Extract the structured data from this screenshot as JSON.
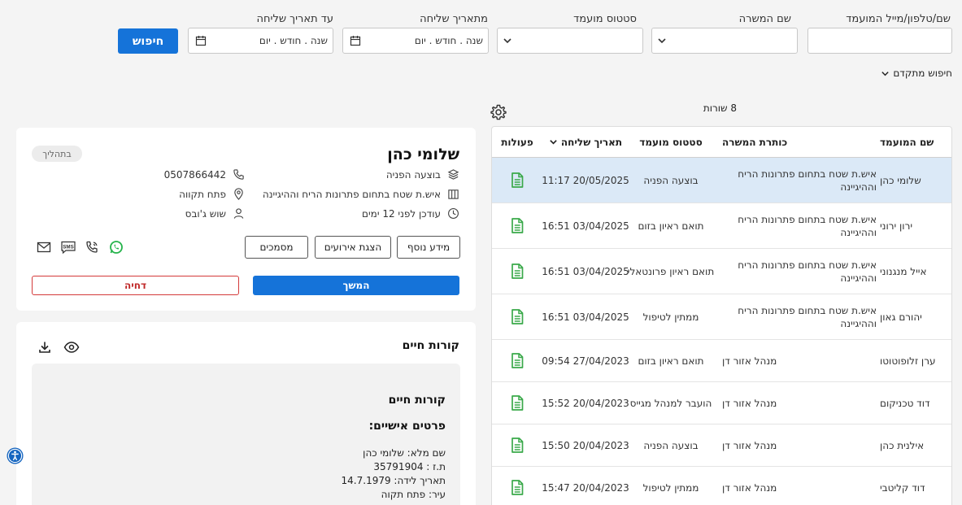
{
  "filters": {
    "candidate_search": {
      "label": "שם/טלפון/מייל המועמד",
      "value": ""
    },
    "job_name": {
      "label": "שם המשרה",
      "value": ""
    },
    "candidate_status": {
      "label": "סטטוס מועמד",
      "value": ""
    },
    "from_date": {
      "label": "מתאריך שליחה",
      "placeholder": "שנה . חודש . יום"
    },
    "to_date": {
      "label": "עד תאריך שליחה",
      "placeholder": "שנה . חודש . יום"
    },
    "search_label": "חיפוש",
    "advanced_search_label": "חיפוש מתקדם"
  },
  "table": {
    "row_count": "8 שורות",
    "headers": {
      "name": "שם המועמד",
      "job": "כותרת המשרה",
      "status": "סטטוס מועמד",
      "date": "תאריך שליחה",
      "actions": "פעולות"
    },
    "rows": [
      {
        "name": "שלומי כהן",
        "job": "איש.ת שטח בתחום פתרונות הריח וההיגיינה",
        "status": "בוצעה הפניה",
        "date": "20/05/2025 11:17"
      },
      {
        "name": "ירון ירוני",
        "job": "איש.ת שטח בתחום פתרונות הריח וההיגיינה",
        "status": "תואם ראיון בזום",
        "date": "03/04/2025 16:51"
      },
      {
        "name": "אייל מנגנוני",
        "job": "איש.ת שטח בתחום פתרונות הריח וההיגיינה",
        "status": "תואם ראיון פרונטאלי",
        "date": "03/04/2025 16:51"
      },
      {
        "name": "יהורם גאון",
        "job": "איש.ת שטח בתחום פתרונות הריח וההיגיינה",
        "status": "ממתין לטיפול",
        "date": "03/04/2025 16:51"
      },
      {
        "name": "ערן זלופוטוטו",
        "job": "מנהל אזור דן",
        "status": "תואם ראיון בזום",
        "date": "27/04/2023 09:54"
      },
      {
        "name": "דוד טכניקום",
        "job": "מנהל אזור דן",
        "status": "הועבר למנהל מגייס",
        "date": "20/04/2023 15:52"
      },
      {
        "name": "אילנית כהן",
        "job": "מנהל אזור דן",
        "status": "בוצעה הפניה",
        "date": "20/04/2023 15:50"
      },
      {
        "name": "דוד קליטבי",
        "job": "מנהל אזור דן",
        "status": "ממתין לטיפול",
        "date": "20/04/2023 15:47"
      }
    ]
  },
  "candidate": {
    "name": "שלומי כהן",
    "status_badge": "בתהליך",
    "phone": "0507866442",
    "stage": "בוצעה הפניה",
    "city": "פתח תקווה",
    "job": "איש.ת שטח בתחום פתרונות הריח וההיגיינה",
    "recruiter": "שוש ג'ובס",
    "updated": "עודכן לפני 12 ימים",
    "buttons": {
      "more_info": "מידע נוסף",
      "events": "הצגת אירועים",
      "documents": "מסמכים",
      "continue": "המשך",
      "reject": "דחיה"
    },
    "sms_label": "SMS"
  },
  "resume": {
    "section_title": "קורות חיים",
    "doc_title": "קורות חיים",
    "personal_title": "פרטים אישיים:",
    "lines": [
      "שם מלא: שלומי כהן",
      "ת.ז : 35791904",
      "תאריך לידה: 14.7.1979",
      "עיר: פתח תקוה"
    ]
  },
  "colors": {
    "primary": "#1573d9",
    "reject": "#d43a3a",
    "whatsapp": "#25b34b",
    "doc_icon": "#3aa94a",
    "selected_row": "#dbe9f7"
  }
}
